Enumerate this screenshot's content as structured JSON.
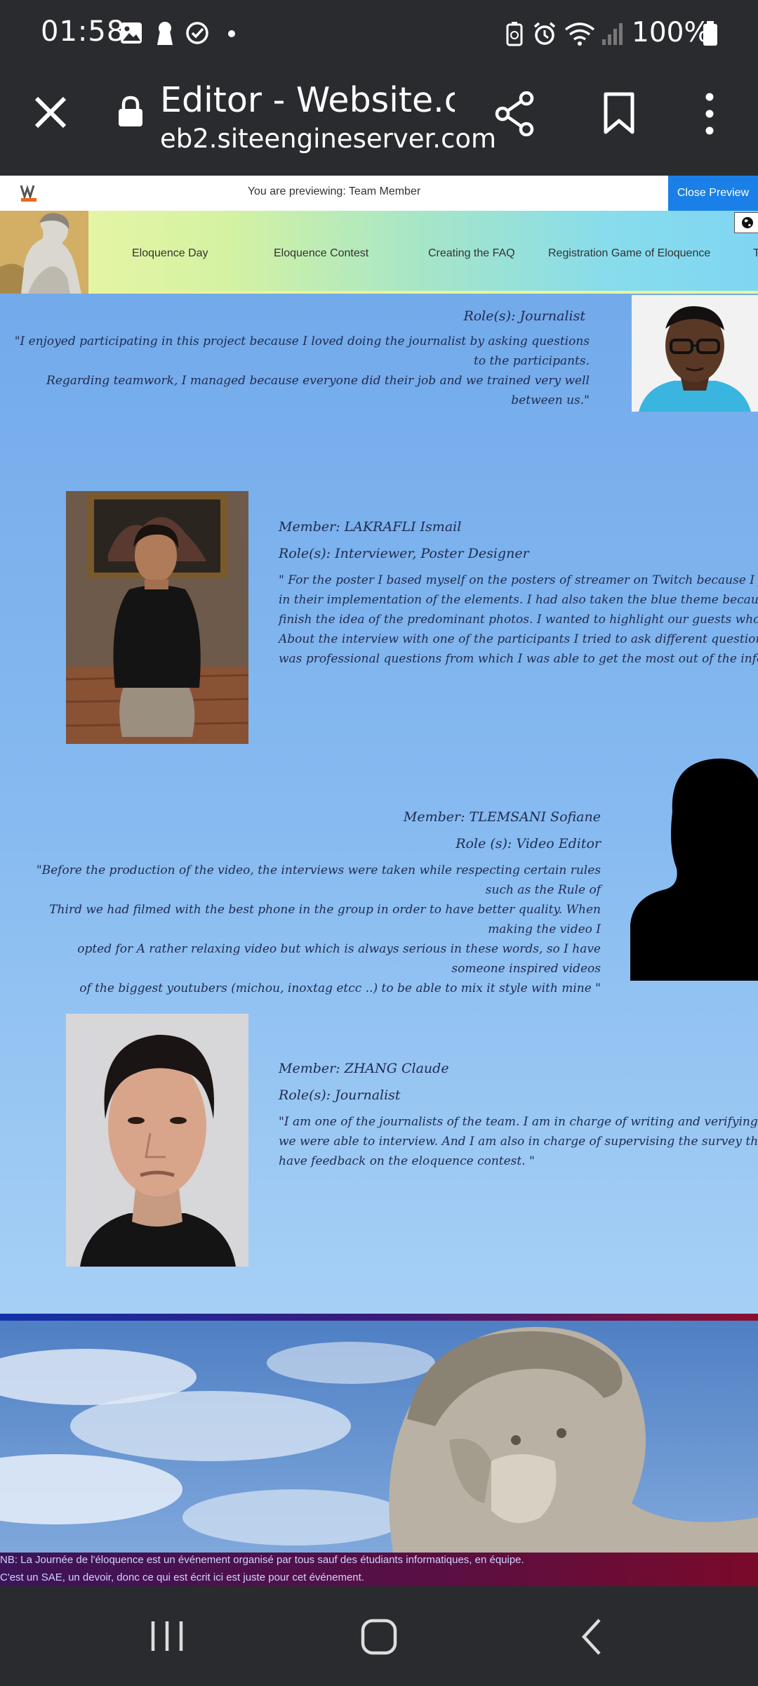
{
  "status_bar": {
    "time": "01:58",
    "battery": "100%",
    "icons": [
      "gallery-icon",
      "keyhole-icon",
      "check-circle-icon",
      "dot-icon",
      "battery-saver-icon",
      "alarm-icon",
      "wifi-icon",
      "signal-icon",
      "battery-icon"
    ]
  },
  "browser": {
    "title": "Editor - Website.c…",
    "url": "eb2.siteengineserver.com"
  },
  "preview": {
    "text": "You are previewing: Team Member",
    "close_label": "Close Preview"
  },
  "nav": {
    "items": [
      "Eloquence Day",
      "Eloquence Contest",
      "Creating the FAQ",
      "Registration Game of Eloquence",
      "T"
    ]
  },
  "members": [
    {
      "role": "Role(s): Journalist",
      "quote": [
        "\"I enjoyed participating in this project because I loved doing the journalist by asking questions to the participants.",
        "Regarding teamwork, I managed because everyone did their job and we trained very well between us.\""
      ]
    },
    {
      "name": "Member: LAKRAFLI Ismail",
      "role": "Role(s): Interviewer, Poster Designer",
      "quote": [
        "\" For the poster I based myself on the posters of streamer on Twitch because I found that they were",
        "in their implementation of the elements. I had also taken the blue theme because it goes with the",
        "finish the idea of the predominant photos. I wanted to highlight our guests who could perhaps br",
        "About the interview with one of the participants I tried to ask different questions that you will fi",
        "was professional questions from which I was able to get the most out of the information. \""
      ]
    },
    {
      "name": "Member: TLEMSANI Sofiane",
      "role": "Role (s): Video Editor",
      "quote": [
        "\"Before the production of the video, the interviews were taken while respecting certain rules such as the Rule of",
        "Third we had filmed with the best phone in the group in order to have better quality. When making the video I",
        "opted for A rather relaxing video but which is always serious in these words, so I have someone inspired videos",
        "of the biggest youtubers (michou, inoxtag etcc ..) to be able to mix it style with mine \""
      ]
    },
    {
      "name": "Member: ZHANG Claude",
      "role": "Role(s): Journalist",
      "quote": [
        "\"I am one of the journalists of the team. I am in charge of writing and verifying the image rights",
        "we were able to interview. And I am also in charge of supervising the survey that was sent to stu",
        "have feedback on the eloquence contest. \""
      ]
    }
  ],
  "footer": {
    "note1": "NB: La Journée de l'éloquence est un événement organisé par tous sauf des étudiants informatiques, en équipe.",
    "note2": "C'est un SAE, un devoir, donc ce qui est écrit ici est juste pour cet événement."
  },
  "colors": {
    "page_gradient_top": "#6ea6e9",
    "page_gradient_bottom": "#b7dbf8",
    "preview_button": "#1a7fe6",
    "member_text": "#1f2b4f",
    "system_bar": "#2a2b2f"
  }
}
